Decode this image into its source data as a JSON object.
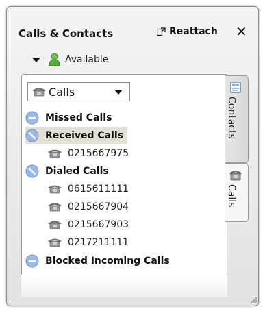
{
  "header": {
    "title": "Calls & Contacts",
    "reattach_label": "Reattach",
    "close_label": "✕"
  },
  "presence": {
    "status": "Available"
  },
  "view_select": {
    "selected": "Calls"
  },
  "groups": [
    {
      "label": "Missed Calls",
      "entries": []
    },
    {
      "label": "Received Calls",
      "entries": [
        "0215667975"
      ]
    },
    {
      "label": "Dialed Calls",
      "entries": [
        "0615611111",
        "0215667904",
        "0215667903",
        "0217211111"
      ]
    },
    {
      "label": "Blocked Incoming Calls",
      "entries": []
    }
  ],
  "side_tabs": [
    {
      "label": "Contacts",
      "icon": "contacts-icon"
    },
    {
      "label": "Calls",
      "icon": "phone-icon"
    }
  ],
  "colors": {
    "selected_row": "#e4e0d6",
    "group_icon_blue": "#9ab8e8",
    "presence_green": "#58b13a"
  }
}
